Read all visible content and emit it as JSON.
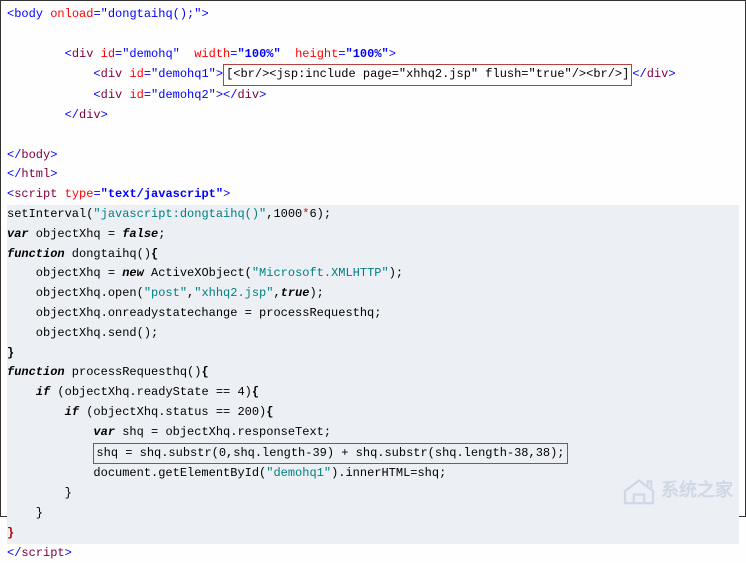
{
  "l1_body_open": "<body ",
  "l1_onload_attr": "onload",
  "l1_eq": "=",
  "l1_onload_val": "\"dongtaihq();\"",
  "l1_body_close": ">",
  "l3_open": "        <",
  "l3_div": "div",
  "l3_sp": " ",
  "l3_id": "id",
  "l3_eq": "=",
  "l3_idv": "\"demohq\"",
  "l3_sp2": "  ",
  "l3_w": "width",
  "l3_wv": "\"100%\"",
  "l3_h": "height",
  "l3_hv": "\"100%\"",
  "l3_close": ">",
  "l4_pre": "            <",
  "l4_div": "div",
  "l4_id": "id",
  "l4_idv": "\"demohq1\"",
  "l4_gt": ">",
  "l4_box": "[<br/><jsp:include page=\"xhhq2.jsp\" flush=\"true\"/><br/>]",
  "l4_end": "</",
  "l4_endname": "div",
  "l4_endgt": ">",
  "l5_pre": "            <",
  "l5_div": "div",
  "l5_id": "id",
  "l5_idv": "\"demohq2\"",
  "l5_gt": "></",
  "l5_endname": "div",
  "l5_endgt": ">",
  "l6": "        </",
  "l6_div": "div",
  "l6_gt": ">",
  "l8": "</",
  "l8_body": "body",
  "l8_gt": ">",
  "l9": "</",
  "l9_html": "html",
  "l9_gt": ">",
  "l10_open": "<",
  "l10_script": "script",
  "l10_type": "type",
  "l10_tv": "\"text/javascript\"",
  "l10_gt": ">",
  "s1a": "setInterval(",
  "s1b": "\"javascript:dongtaihq()\"",
  "s1c": ",1000",
  "s1d": "*",
  "s1e": "6);",
  "s2a": "var",
  "s2b": " objectXhq = ",
  "s2c": "false",
  "s2d": ";",
  "s3a": "function",
  "s3b": " dongtaihq()",
  "s3c": "{",
  "s4a": "    objectXhq = ",
  "s4b": "new",
  "s4c": " ActiveXObject(",
  "s4d": "\"Microsoft.XMLHTTP\"",
  "s4e": ");",
  "s5a": "    objectXhq.open(",
  "s5b": "\"post\"",
  "s5c": ",",
  "s5d": "\"xhhq2.jsp\"",
  "s5e": ",",
  "s5f": "true",
  "s5g": ");",
  "s6": "    objectXhq.onreadystatechange = processRequesthq;",
  "s7": "    objectXhq.send();",
  "s8": "}",
  "s9a": "function",
  "s9b": " processRequesthq()",
  "s9c": "{",
  "s10a": "    ",
  "s10b": "if",
  "s10c": " (objectXhq.readyState == 4)",
  "s10d": "{",
  "s11a": "        ",
  "s11b": "if",
  "s11c": " (objectXhq.status == 200)",
  "s11d": "{",
  "s12a": "            ",
  "s12b": "var",
  "s12c": " shq = objectXhq.responseText;",
  "s13pre": "            ",
  "s13": "shq = shq.substr(0,shq.length-39) + shq.substr(shq.length-38,38);",
  "s14a": "            document.getElementById(",
  "s14b": "\"demohq1\"",
  "s14c": ").innerHTML=shq;",
  "s15": "        }",
  "s16": "    }",
  "s17": "}",
  "s18a": "</",
  "s18b": "script",
  "s18c": ">",
  "watermark": "系统之家"
}
